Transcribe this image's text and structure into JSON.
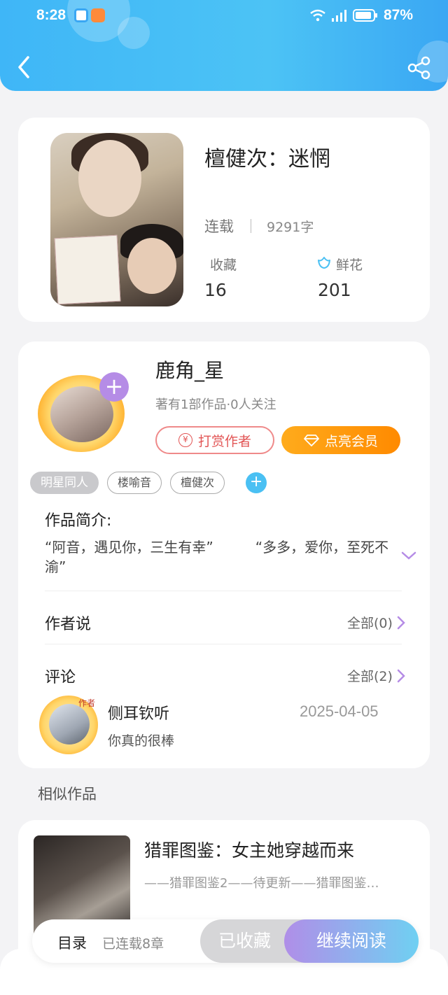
{
  "status_bar": {
    "time": "8:28",
    "battery": "87%"
  },
  "book": {
    "title": "檀健次：迷惘",
    "status": "连载",
    "word_count": "9291字",
    "collect_label": "收藏",
    "collect_value": "16",
    "flower_label": "鲜花",
    "flower_value": "201"
  },
  "author": {
    "name": "鹿角_星",
    "meta": "著有1部作品·0人关注",
    "tip_button": "打赏作者",
    "vip_button": "点亮会员",
    "tags": [
      "明星同人",
      "楼喻音",
      "檀健次"
    ]
  },
  "intro": {
    "label": "作品简介:",
    "text": "“阿音，遇见你，三生有幸”　　　“多多，爱你，至死不渝”"
  },
  "author_says": {
    "label": "作者说",
    "link": "全部(0)"
  },
  "comments": {
    "label": "评论",
    "link": "全部(2)",
    "items": [
      {
        "user": "侧耳钦听",
        "date": "2025-04-05",
        "text": "你真的很棒",
        "badge": "作者"
      }
    ]
  },
  "similar": {
    "label": "相似作品",
    "items": [
      {
        "title": "猎罪图鉴：女主她穿越而来",
        "desc": "——猎罪图鉴2——待更新——猎罪图鉴…"
      }
    ]
  },
  "bottom_bar": {
    "toc_label": "目录",
    "toc_count": "已连载8章",
    "collected_button": "已收藏",
    "read_button": "继续阅读"
  },
  "colors": {
    "header": "#3fb6f7",
    "accent_purple": "#b58ce6",
    "vip_orange": "#ff8a00",
    "tip_red": "#e25555"
  },
  "icons": [
    "back-icon",
    "share-icon",
    "flower-icon",
    "plus-icon",
    "yen-icon",
    "diamond-icon",
    "chevron-down-icon",
    "chevron-right-icon"
  ]
}
